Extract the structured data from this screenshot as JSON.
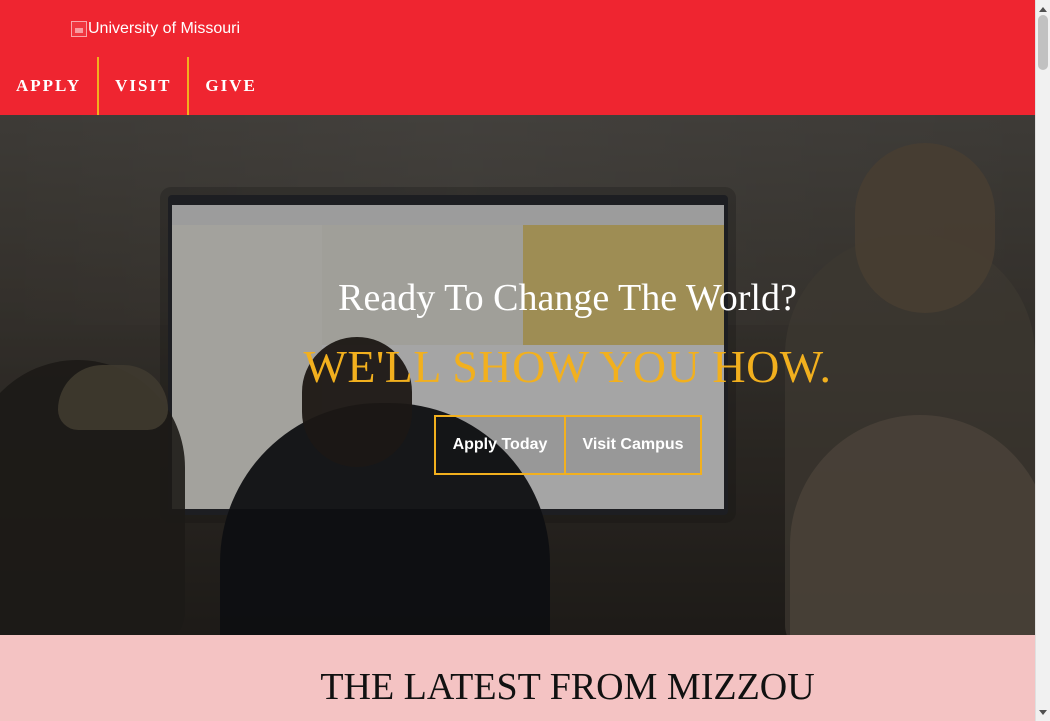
{
  "header": {
    "logo_alt": "University of Missouri",
    "nav": [
      {
        "label": "APPLY"
      },
      {
        "label": "VISIT"
      },
      {
        "label": "GIVE"
      }
    ]
  },
  "hero": {
    "title": "Ready To Change The World?",
    "subtitle": "WE'LL SHOW YOU HOW.",
    "buttons": {
      "apply_label": "Apply Today",
      "visit_label": "Visit Campus"
    }
  },
  "latest": {
    "title": "THE LATEST FROM MIZZOU"
  },
  "colors": {
    "brand_red": "#ef2530",
    "accent_gold": "#f2b01e",
    "latest_bg": "#f4c3c3",
    "text_dark": "#111111",
    "white": "#ffffff"
  },
  "icons": {
    "broken_image": "broken-image-icon",
    "scroll_up": "scroll-up-icon",
    "scroll_down": "scroll-down-icon"
  }
}
